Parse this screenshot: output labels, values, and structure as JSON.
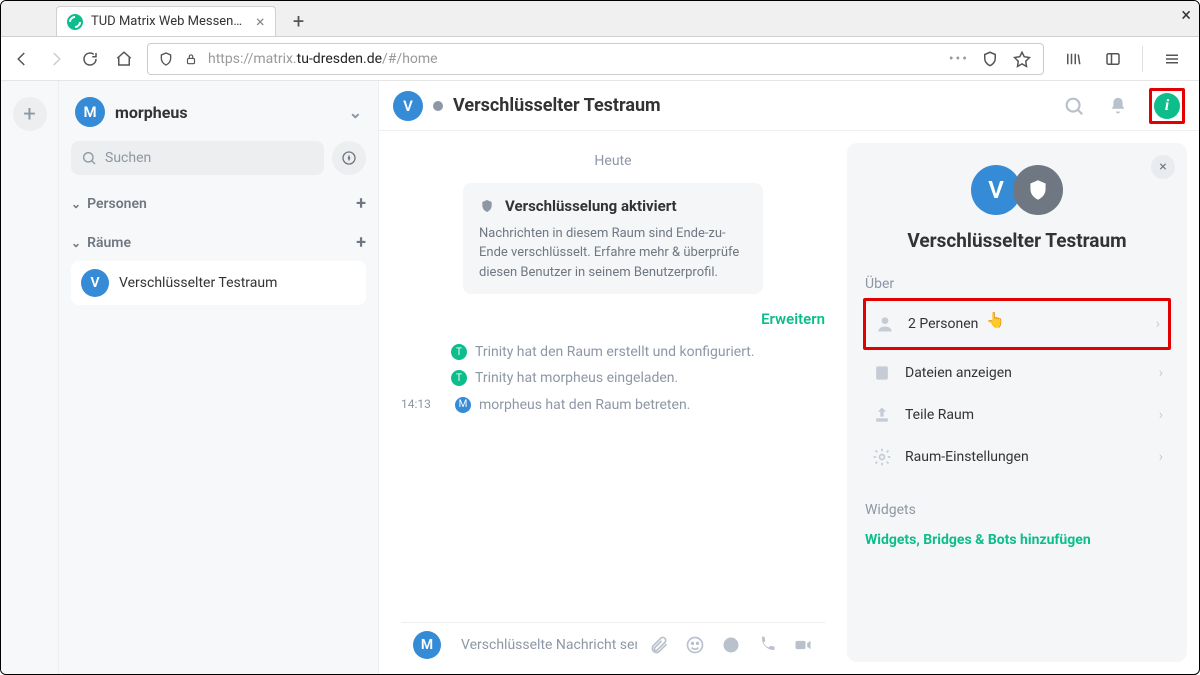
{
  "browser": {
    "tab_title": "TUD Matrix Web Messen…",
    "url_pre": "https://matrix.",
    "url_host": "tu-dresden.de",
    "url_path": "/#/home"
  },
  "sidebar": {
    "username": "morpheus",
    "search_placeholder": "Suchen",
    "sections": {
      "people": "Personen",
      "rooms": "Räume"
    },
    "room_name": "Verschlüsselter Testraum"
  },
  "room": {
    "title": "Verschlüsselter Testraum",
    "date_label": "Heute",
    "enc_card": {
      "title": "Verschlüsselung aktiviert",
      "body": "Nachrichten in diesem Raum sind Ende-zu-Ende verschlüsselt. Erfahre mehr & überprüfe diesen Benutzer in seinem Benutzerprofil."
    },
    "expand": "Erweitern",
    "events": {
      "e1": "Trinity hat den Raum erstellt und konfiguriert.",
      "e2": "Trinity hat morpheus eingeladen.",
      "e3_time": "14:13",
      "e3": "morpheus hat den Raum betreten."
    },
    "composer_placeholder": "Verschlüsselte Nachricht sen"
  },
  "rightpanel": {
    "title": "Verschlüsselter Testraum",
    "about_label": "Über",
    "items": {
      "people": "2 Personen",
      "files": "Dateien anzeigen",
      "share": "Teile Raum",
      "settings": "Raum-Einstellungen"
    },
    "widgets_label": "Widgets",
    "add_widgets": "Widgets, Bridges & Bots hinzufügen"
  }
}
